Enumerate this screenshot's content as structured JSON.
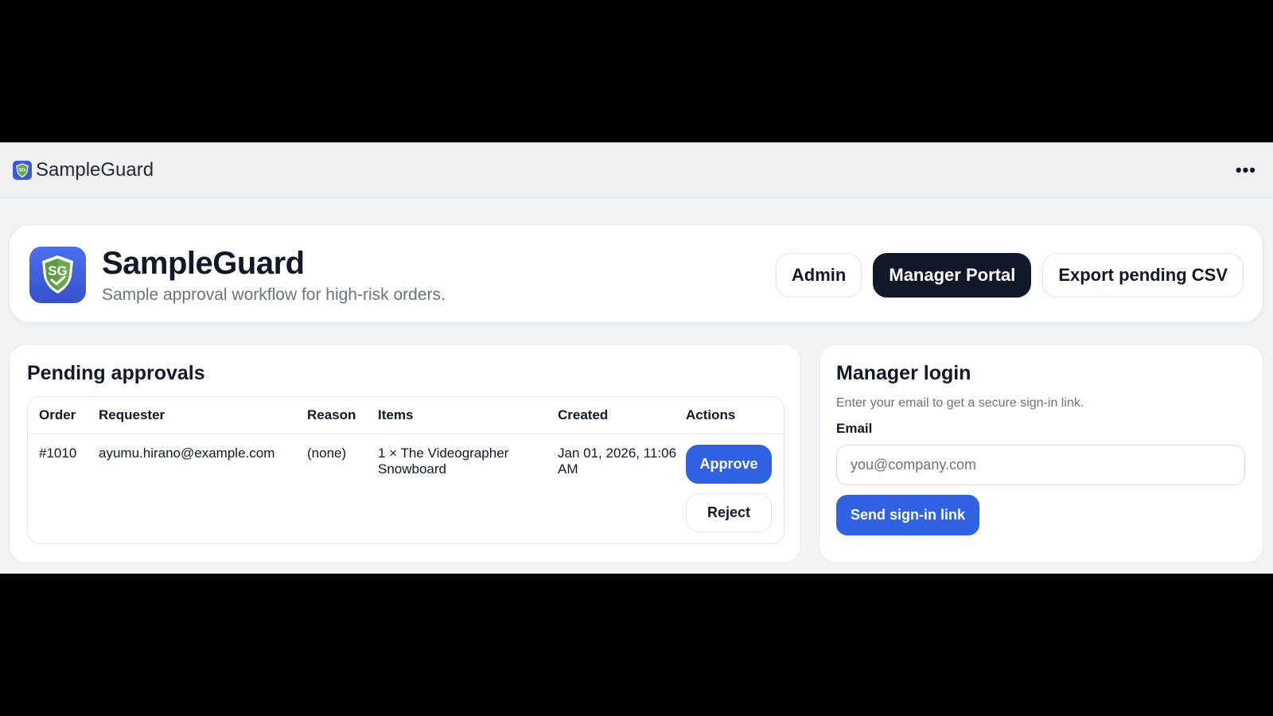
{
  "appbar": {
    "title": "SampleGuard",
    "more_icon": "more-horizontal-icon"
  },
  "header": {
    "logo_text": "SG",
    "title": "SampleGuard",
    "subtitle": "Sample approval workflow for high-risk orders.",
    "buttons": {
      "admin": "Admin",
      "manager_portal": "Manager Portal",
      "export": "Export pending CSV"
    }
  },
  "pending": {
    "title": "Pending approvals",
    "columns": [
      "Order",
      "Requester",
      "Reason",
      "Items",
      "Created",
      "Actions"
    ],
    "rows": [
      {
        "order": "#1010",
        "requester": "ayumu.hirano@example.com",
        "reason": "(none)",
        "items": "1 × The Videographer Snowboard",
        "created": "Jan 01, 2026, 11:06 AM",
        "approve_label": "Approve",
        "reject_label": "Reject"
      }
    ]
  },
  "login": {
    "title": "Manager login",
    "subtitle": "Enter your email to get a secure sign-in link.",
    "email_label": "Email",
    "email_placeholder": "you@company.com",
    "email_value": "",
    "submit_label": "Send sign-in link"
  },
  "colors": {
    "primary": "#3063e3",
    "dark": "#111827",
    "muted": "#6b7280",
    "logo_blue": "#3b5bdb",
    "logo_green": "#6aa84f"
  }
}
